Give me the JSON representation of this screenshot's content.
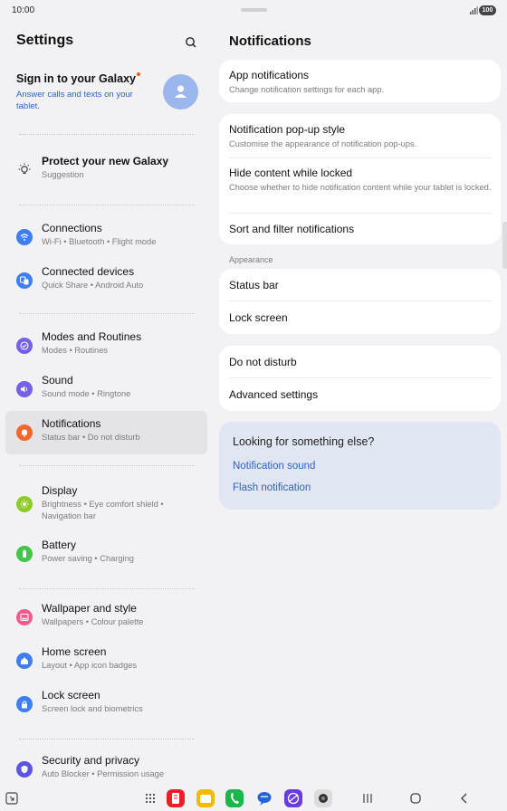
{
  "status": {
    "time": "10:00",
    "battery": "100"
  },
  "settings": {
    "title": "Settings",
    "signin": {
      "title": "Sign in to your Galaxy",
      "subtitle": "Answer calls and texts on your tablet."
    },
    "items": [
      {
        "title": "Protect your new Galaxy",
        "subtitle": "Suggestion"
      },
      {
        "title": "Connections",
        "subtitle": "Wi-Fi  •  Bluetooth  •  Flight mode"
      },
      {
        "title": "Connected devices",
        "subtitle": "Quick Share  •  Android Auto"
      },
      {
        "title": "Modes and Routines",
        "subtitle": "Modes  •  Routines"
      },
      {
        "title": "Sound",
        "subtitle": "Sound mode  •  Ringtone"
      },
      {
        "title": "Notifications",
        "subtitle": "Status bar  •  Do not disturb"
      },
      {
        "title": "Display",
        "subtitle": "Brightness  •  Eye comfort shield  •  Navigation bar"
      },
      {
        "title": "Battery",
        "subtitle": "Power saving  •  Charging"
      },
      {
        "title": "Wallpaper and style",
        "subtitle": "Wallpapers  •  Colour palette"
      },
      {
        "title": "Home screen",
        "subtitle": "Layout  •  App icon badges"
      },
      {
        "title": "Lock screen",
        "subtitle": "Screen lock and biometrics"
      },
      {
        "title": "Security and privacy",
        "subtitle": "Auto Blocker  •  Permission usage"
      }
    ]
  },
  "notifications": {
    "title": "Notifications",
    "app_notifications": {
      "title": "App notifications",
      "subtitle": "Change notification settings for each app."
    },
    "popup_style": {
      "title": "Notification pop-up style",
      "subtitle": "Customise the appearance of notification pop-ups."
    },
    "hide_content": {
      "title": "Hide content while locked",
      "subtitle": "Choose whether to hide notification content while your tablet is locked."
    },
    "sort_filter": {
      "title": "Sort and filter notifications"
    },
    "appearance_label": "Appearance",
    "status_bar": "Status bar",
    "lock_screen": "Lock screen",
    "do_not_disturb": "Do not disturb",
    "advanced": "Advanced settings",
    "suggest": {
      "title": "Looking for something else?",
      "link1": "Notification sound",
      "link2": "Flash notification"
    }
  },
  "colors": {
    "accent_link": "#2e63c9",
    "connections": "#3e7ef2",
    "modes": "#7461e6",
    "notifications": "#f4672b",
    "display": "#8ccb2a",
    "battery": "#45c44b",
    "wallpaper": "#ee5c8d",
    "security": "#5b55e0"
  },
  "navbar": {
    "icons": [
      "accessibility-icon",
      "app-drawer-icon",
      "app-red",
      "app-yellow",
      "phone-app",
      "messages-app",
      "internet-app",
      "camera-app",
      "recents-icon",
      "home-icon",
      "back-icon"
    ]
  }
}
